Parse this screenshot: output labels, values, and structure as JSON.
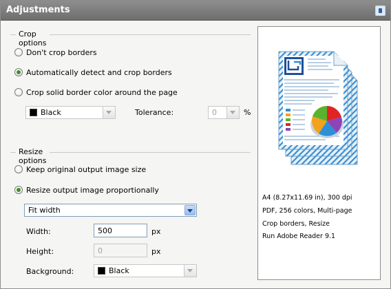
{
  "window": {
    "title": "Adjustments"
  },
  "crop": {
    "group_label": "Crop options",
    "options": [
      {
        "label": "Don't crop borders",
        "selected": false
      },
      {
        "label": "Automatically detect and crop borders",
        "selected": true
      },
      {
        "label": "Crop solid border color around the page",
        "selected": false
      }
    ],
    "color_value": "Black",
    "tolerance_label": "Tolerance:",
    "tolerance_value": "0",
    "tolerance_unit": "%"
  },
  "resize": {
    "group_label": "Resize options",
    "options": [
      {
        "label": "Keep original output image size",
        "selected": false
      },
      {
        "label": "Resize output image proportionally",
        "selected": true
      }
    ],
    "mode_value": "Fit width",
    "width_label": "Width:",
    "width_value": "500",
    "width_unit": "px",
    "height_label": "Height:",
    "height_value": "0",
    "height_unit": "px",
    "background_label": "Background:",
    "background_value": "Black"
  },
  "preview": {
    "icon": "document-pie-chart-icon",
    "info": [
      "A4 (8.27x11.69 in), 300 dpi",
      "PDF, 256 colors, Multi-page",
      "Crop borders, Resize",
      "Run Adobe Reader 9.1"
    ]
  },
  "colors": {
    "accent": "#3f8f27",
    "title_bar": "#7a7a7a",
    "link_blue": "#2e5fa3"
  }
}
